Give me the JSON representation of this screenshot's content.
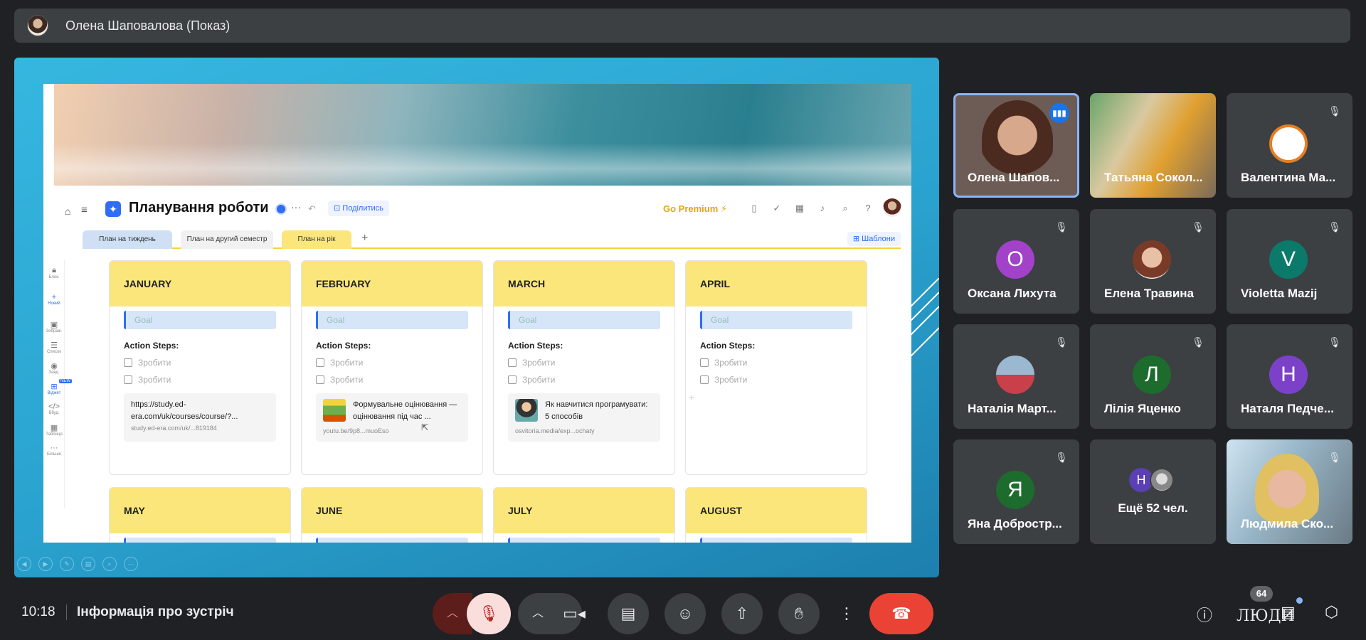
{
  "presenter": {
    "name": "Олена Шаповалова (Показ)"
  },
  "document": {
    "title": "Планування роботи",
    "share_label": "Поділитись",
    "premium_label": "Go Premium",
    "tabs": [
      "План на тиждень",
      "План на другий семестр",
      "План на рік"
    ],
    "active_tab": "План на рік",
    "templates_label": "Шаблони",
    "tools": [
      {
        "icon": "lock-icon",
        "label": "Блок."
      },
      {
        "icon": "plus-icon",
        "label": "Новий"
      },
      {
        "icon": "image-icon",
        "label": "Зображ."
      },
      {
        "icon": "list-icon",
        "label": "Список"
      },
      {
        "icon": "check-icon",
        "label": "Завд."
      },
      {
        "icon": "widget-icon",
        "label": "Віджет",
        "tag": "NEW"
      },
      {
        "icon": "code-icon",
        "label": "Вбуд."
      },
      {
        "icon": "table-icon",
        "label": "Таблиця"
      },
      {
        "icon": "more-icon",
        "label": "Більше"
      }
    ],
    "goal_placeholder": "Goal",
    "action_steps_label": "Action Steps:",
    "todo_placeholder": "Зробити",
    "months_row1": [
      {
        "name": "JANUARY",
        "link": {
          "title": "https://study.ed-era.com/uk/courses/course/?...",
          "url": "study.ed-era.com/uk/...819184"
        }
      },
      {
        "name": "FEBRUARY",
        "link": {
          "title": "Формувальне оцінювання — оцінювання під час ...",
          "url": "youtu.be/9p8...muoEso"
        }
      },
      {
        "name": "MARCH",
        "link": {
          "title": "Як навчитися програмувати: 5 способів",
          "url": "osvitoria.media/exp...ochaty"
        }
      },
      {
        "name": "APRIL"
      }
    ],
    "months_row2": [
      "MAY",
      "JUNE",
      "JULY",
      "AUGUST"
    ]
  },
  "participants": [
    {
      "name": "Олена Шапов...",
      "speaking": true
    },
    {
      "name": "Татьяна Сокол..."
    },
    {
      "name": "Валентина Ма...",
      "muted": true
    },
    {
      "name": "Оксана Лихута",
      "muted": true,
      "initial": "О",
      "color": "#a142c9"
    },
    {
      "name": "Елена Травина",
      "muted": true
    },
    {
      "name": "Violetta Mazij",
      "muted": true,
      "initial": "V",
      "color": "#0b7a6a"
    },
    {
      "name": "Наталія Март...",
      "muted": true
    },
    {
      "name": "Лілія Яценко",
      "muted": true,
      "initial": "Л",
      "color": "#1e6b2e"
    },
    {
      "name": "Наталя Педче...",
      "muted": true,
      "initial": "Н",
      "color": "#7b42c9"
    },
    {
      "name": "Яна Добростр...",
      "muted": true,
      "initial": "Я",
      "color": "#1e6b2e"
    },
    {
      "name": "Ещё 52 чел.",
      "initial": "Н",
      "color": "#5b3fb5"
    },
    {
      "name": "Людмила Ско...",
      "muted": true
    }
  ],
  "meeting": {
    "time": "10:18",
    "info_label": "Інформація про зустріч",
    "people_count": "64",
    "people_label": "ЛЮДИ"
  },
  "colors": {
    "background": "#202124",
    "end_call": "#ea4335",
    "speaking": "#8ab4f8",
    "month_header": "#fbe67c"
  }
}
